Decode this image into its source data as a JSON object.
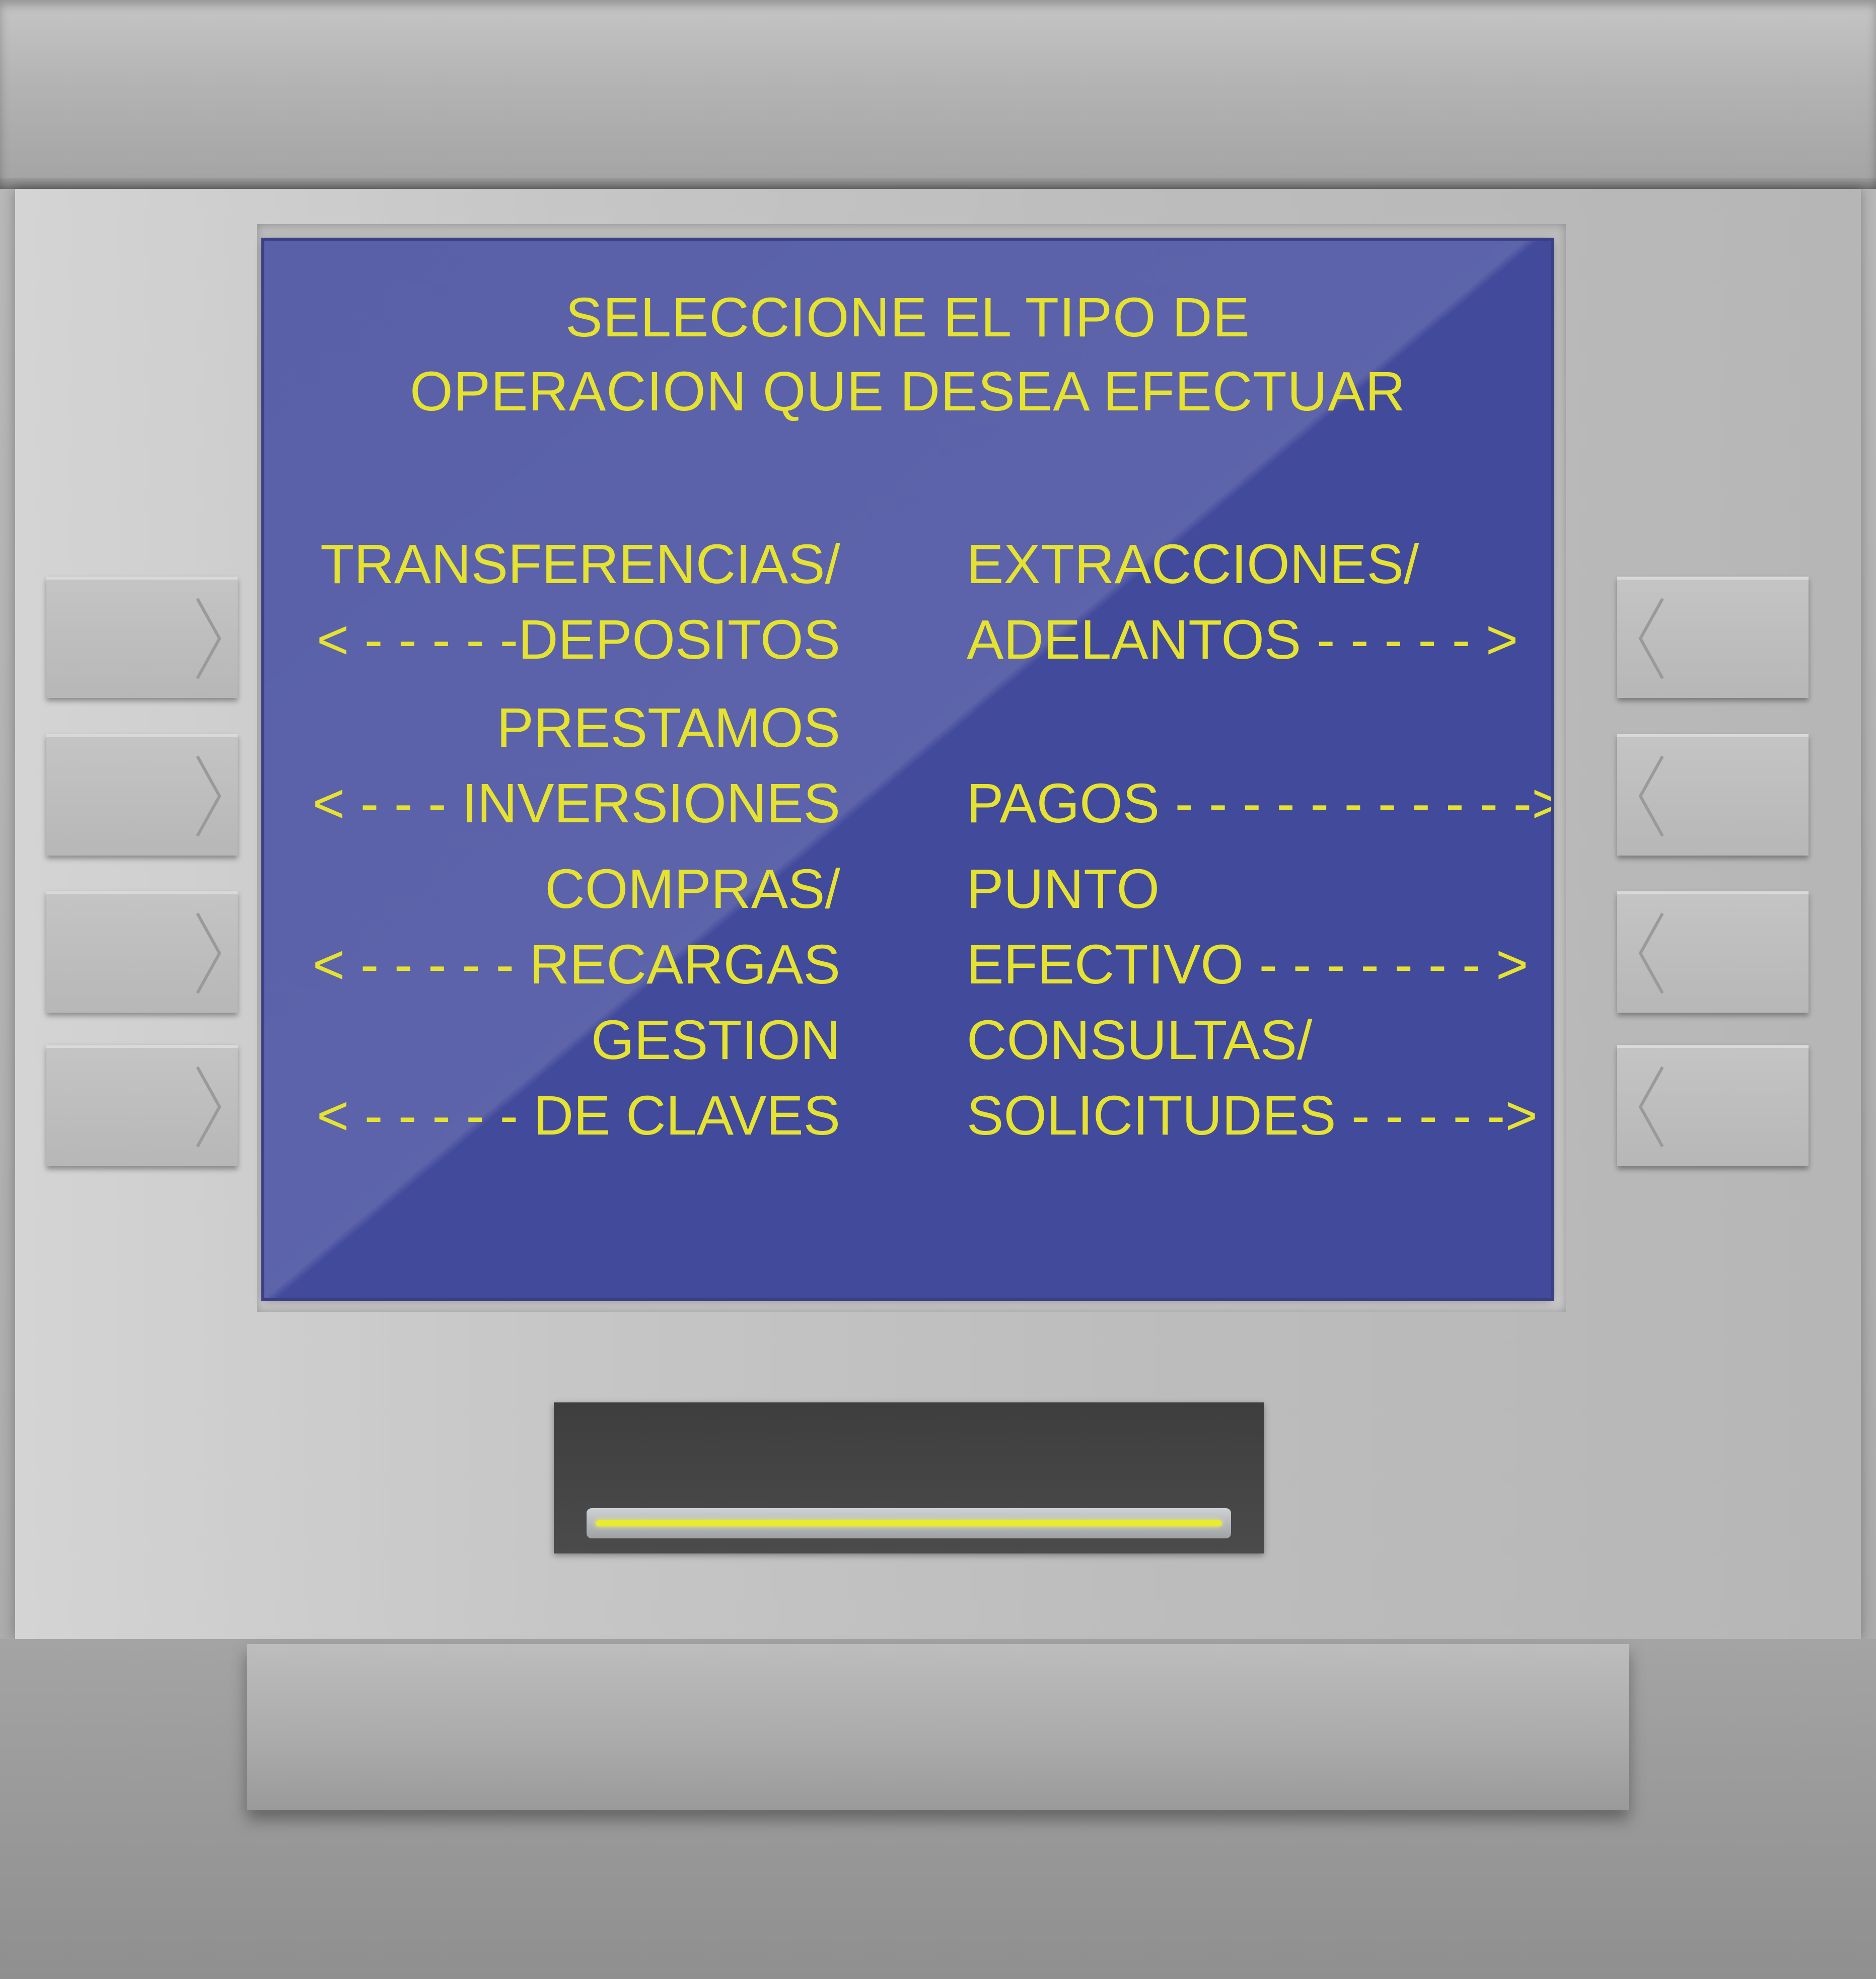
{
  "screen": {
    "title_line1": "SELECCIONE EL TIPO DE",
    "title_line2": "OPERACION QUE DESEA EFECTUAR",
    "left_options": [
      {
        "line1": "TRANSFERENCIAS/",
        "line2": "< - - - - -DEPOSITOS"
      },
      {
        "line1": "PRESTAMOS",
        "line2": "< - - - INVERSIONES"
      },
      {
        "line1": "COMPRAS/",
        "line2": "< - - - - - RECARGAS"
      },
      {
        "line1": "GESTION",
        "line2": "< - - - - - DE CLAVES"
      }
    ],
    "right_options": [
      {
        "line1": "EXTRACCIONES/",
        "line2": "ADELANTOS - - - - - >"
      },
      {
        "line1": "",
        "line2": "PAGOS - - - - - - - - - - ->"
      },
      {
        "line1": "PUNTO",
        "line2": "EFECTIVO - - - - - - - >"
      },
      {
        "line1": "CONSULTAS/",
        "line2": "SOLICITUDES - - - - ->"
      }
    ],
    "text_color": "#e6e230",
    "background_color": "#424a9c"
  },
  "side_buttons": {
    "left_icon": "chevron-right-icon",
    "right_icon": "chevron-left-icon"
  }
}
